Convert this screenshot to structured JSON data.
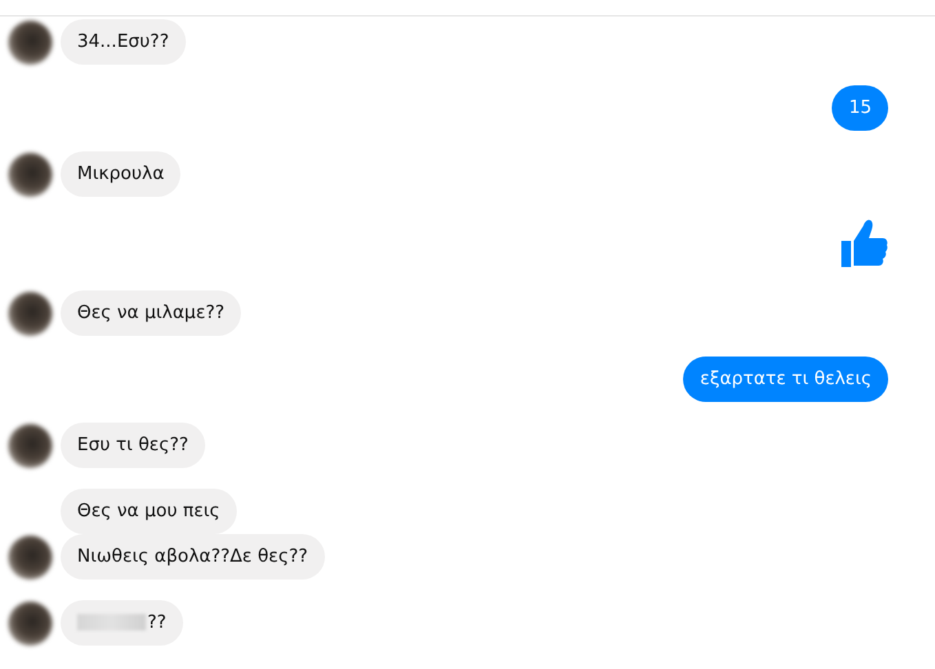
{
  "messages": [
    {
      "kind": "text",
      "outgoing": false,
      "avatar": true,
      "text": "34...Εσυ??"
    },
    {
      "kind": "text",
      "outgoing": true,
      "text": "15"
    },
    {
      "kind": "text",
      "outgoing": false,
      "avatar": true,
      "text": "Μικρουλα"
    },
    {
      "kind": "like",
      "outgoing": true
    },
    {
      "kind": "text",
      "outgoing": false,
      "avatar": true,
      "text": "Θες να μιλαμε??"
    },
    {
      "kind": "text",
      "outgoing": true,
      "text": "εξαρτατε τι θελεις"
    },
    {
      "kind": "text",
      "outgoing": false,
      "avatar": true,
      "text": "Εσυ τι θες??"
    },
    {
      "kind": "text",
      "outgoing": false,
      "avatar": false,
      "text": "Θες να μου πεις"
    },
    {
      "kind": "text",
      "outgoing": false,
      "avatar": true,
      "text": "Νιωθεις αβολα??Δε θες??"
    },
    {
      "kind": "redacted",
      "outgoing": false,
      "avatar": true,
      "text": "??"
    }
  ]
}
